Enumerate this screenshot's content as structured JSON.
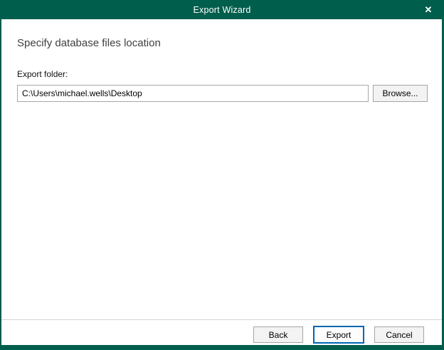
{
  "window": {
    "title": "Export Wizard",
    "close_glyph": "✕"
  },
  "heading": "Specify database files location",
  "form": {
    "label": "Export folder:",
    "path_value": "C:\\Users\\michael.wells\\Desktop",
    "browse_label": "Browse..."
  },
  "footer": {
    "back_label": "Back",
    "export_label": "Export",
    "cancel_label": "Cancel"
  },
  "colors": {
    "titlebar_green": "#005e4c",
    "accent_blue": "#0066b4",
    "heading_text": "#3f3f3f",
    "separator": "#d4d4d4"
  }
}
